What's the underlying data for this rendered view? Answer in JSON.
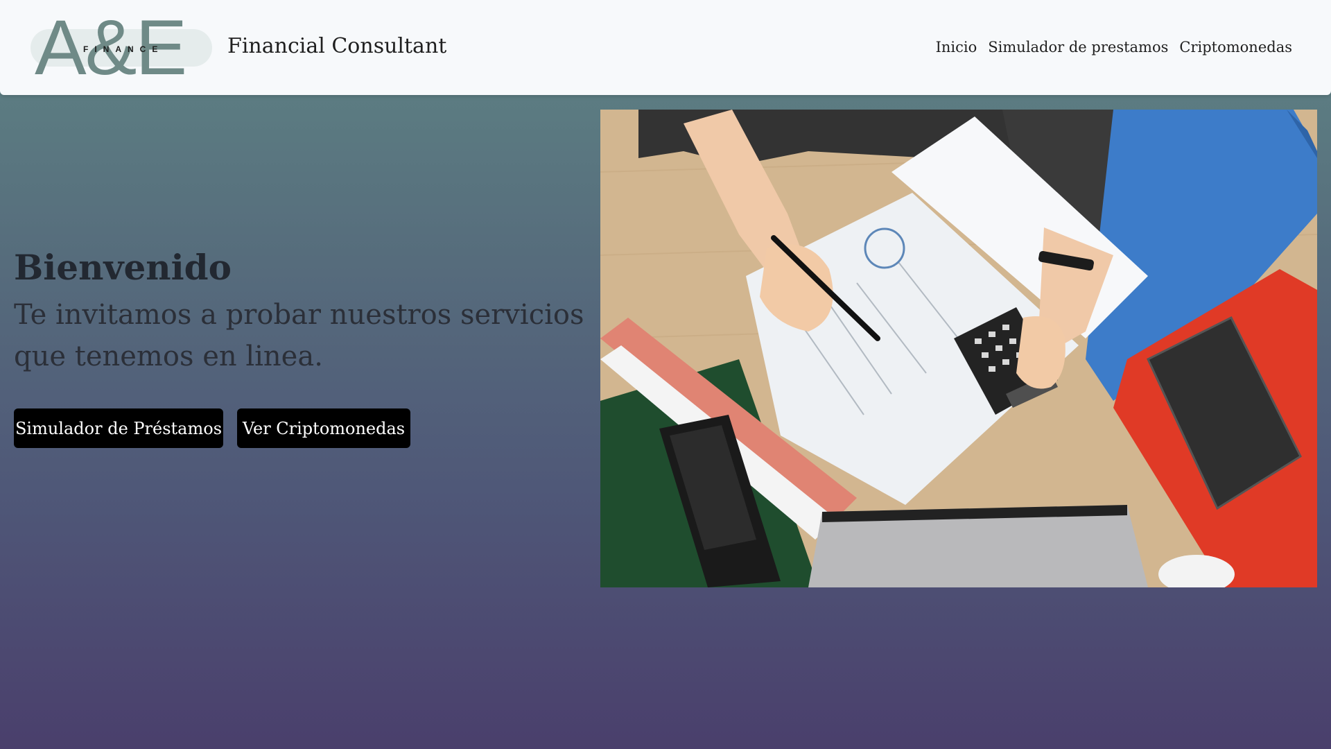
{
  "header": {
    "logo": {
      "letters": "A&E",
      "sub": "FINANCE"
    },
    "brand": "Financial Consultant",
    "nav": [
      {
        "label": "Inicio"
      },
      {
        "label": "Simulador de prestamos"
      },
      {
        "label": "Criptomonedas"
      }
    ]
  },
  "hero": {
    "title": "Bienvenido",
    "subtitle": "Te invitamos a probar nuestros servicios que tenemos en linea.",
    "buttons": {
      "loans": "Simulador de Préstamos",
      "crypto": "Ver Criptomonedas"
    }
  },
  "colors": {
    "header_bg": "#f7f9fb",
    "gradient_top": "#5f8585",
    "gradient_bottom": "#4a3f6c",
    "logo_accent": "#6f8a87",
    "button_bg": "#000000"
  }
}
